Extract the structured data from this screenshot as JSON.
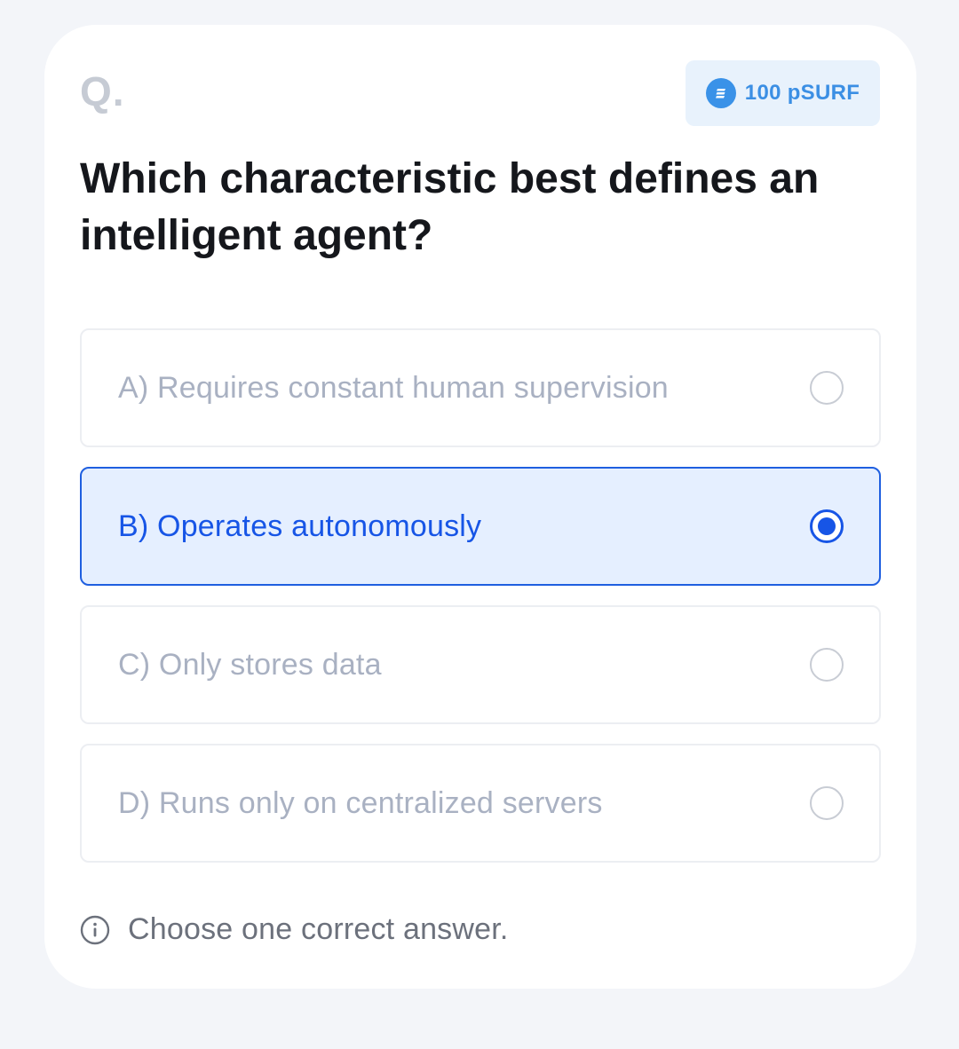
{
  "card": {
    "q_label": "Q.",
    "reward": {
      "icon": "coin-icon",
      "label": "100 pSURF",
      "color": "#3b8fe4"
    },
    "question": "Which characteristic best defines an intelligent agent?"
  },
  "options": [
    {
      "label": "A) Requires constant human supervision",
      "selected": false
    },
    {
      "label": "B) Operates autonomously",
      "selected": true
    },
    {
      "label": "C) Only stores data",
      "selected": false
    },
    {
      "label": "D) Runs only on centralized servers",
      "selected": false
    }
  ],
  "hint": {
    "icon": "info-icon",
    "text": "Choose one correct answer."
  },
  "colors": {
    "accent": "#1755e6",
    "selected_bg": "#e5efff",
    "page_bg": "#f3f5f9"
  }
}
